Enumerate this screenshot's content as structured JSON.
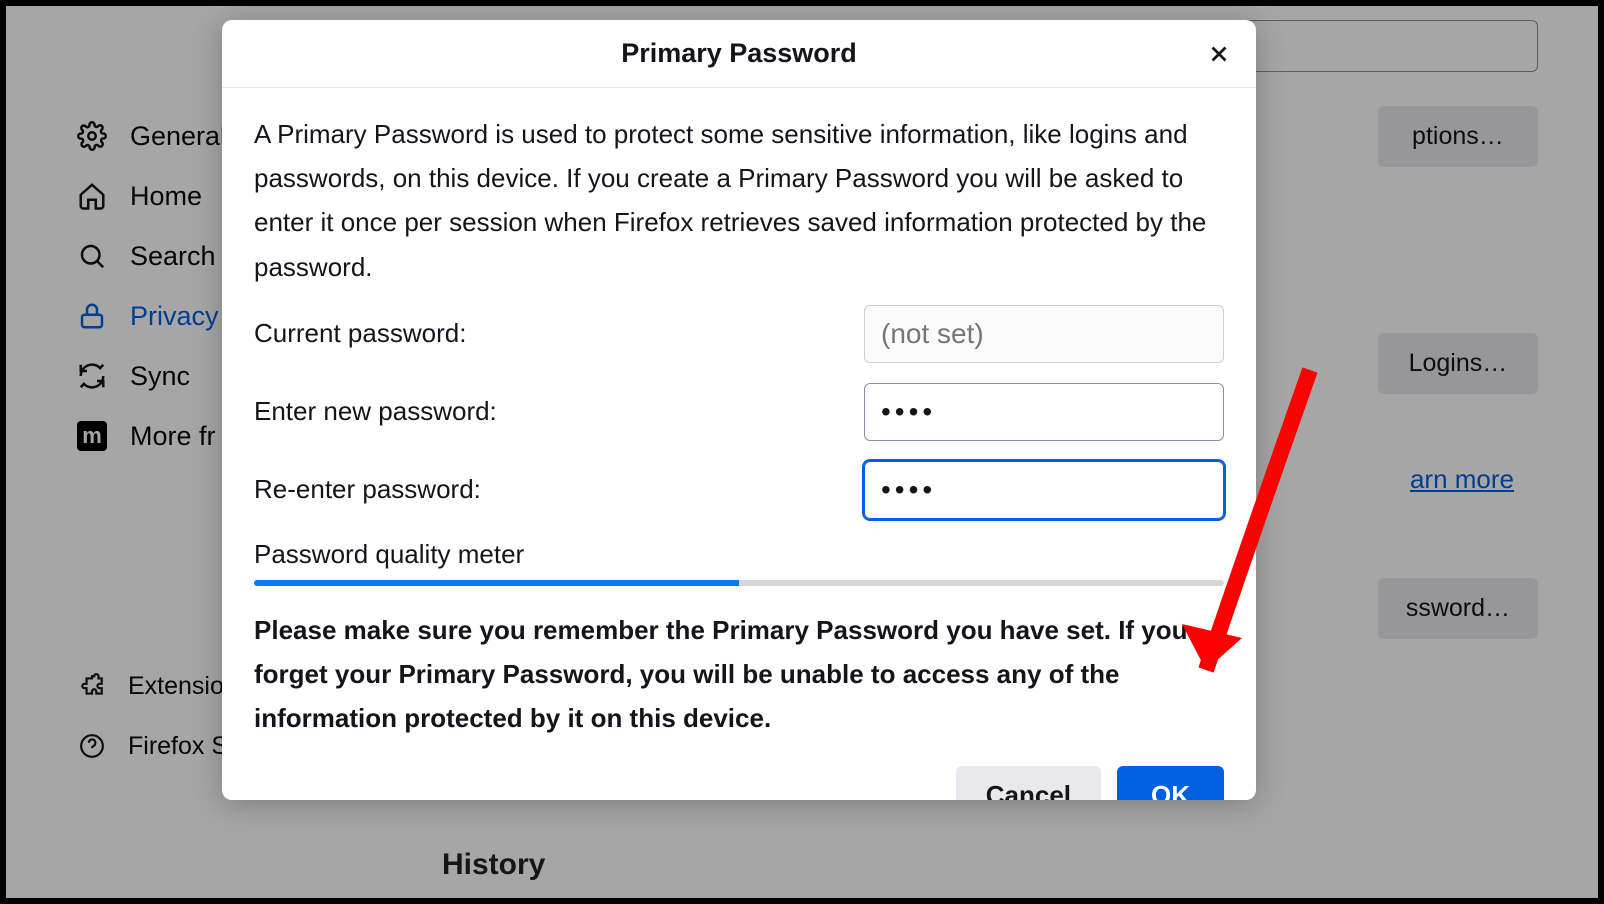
{
  "sidebar": {
    "items": [
      {
        "label": "General"
      },
      {
        "label": "Home"
      },
      {
        "label": "Search"
      },
      {
        "label": "Privacy"
      },
      {
        "label": "Sync"
      },
      {
        "label": "More fr"
      }
    ],
    "bottom": [
      {
        "label": "Extensio"
      },
      {
        "label": "Firefox S"
      }
    ]
  },
  "background": {
    "buttons": {
      "exceptions": "ptions…",
      "savedLogins": "Logins…",
      "changePassword": "ssword…"
    },
    "link": "arn more",
    "history": "History"
  },
  "dialog": {
    "title": "Primary Password",
    "description": "A Primary Password is used to protect some sensitive information, like logins and passwords, on this device. If you create a Primary Password you will be asked to enter it once per session when Firefox retrieves saved information protected by the password.",
    "currentLabel": "Current password:",
    "currentPlaceholder": "(not set)",
    "newLabel": "Enter new password:",
    "newValue": "••••",
    "reenterLabel": "Re-enter password:",
    "reenterValue": "••••",
    "meterLabel": "Password quality meter",
    "meterPercent": 50,
    "warning": "Please make sure you remember the Primary Password you have set. If you forget your Primary Password, you will be unable to access any of the information protected by it on this device.",
    "cancel": "Cancel",
    "ok": "OK"
  }
}
